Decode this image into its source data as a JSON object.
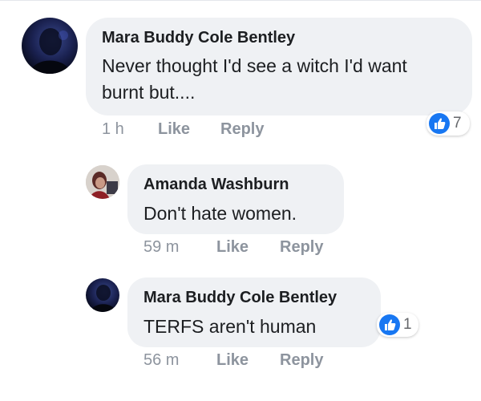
{
  "colors": {
    "bubble_bg": "#eff1f4",
    "text": "#1c1e21",
    "meta": "#8d949e",
    "like_blue": "#1877f2"
  },
  "comments": [
    {
      "author": "Mara Buddy Cole Bentley",
      "text": "Never thought I'd see a witch I'd want burnt but....",
      "time": "1 h",
      "like_label": "Like",
      "reply_label": "Reply",
      "reaction_icon": "thumbs-up-icon",
      "reaction_count": "7"
    },
    {
      "author": "Amanda Washburn",
      "text": "Don't hate women.",
      "time": "59 m",
      "like_label": "Like",
      "reply_label": "Reply"
    },
    {
      "author": "Mara Buddy Cole Bentley",
      "text": "TERFS aren't human",
      "time": "56 m",
      "like_label": "Like",
      "reply_label": "Reply",
      "reaction_icon": "thumbs-up-icon",
      "reaction_count": "1"
    }
  ]
}
